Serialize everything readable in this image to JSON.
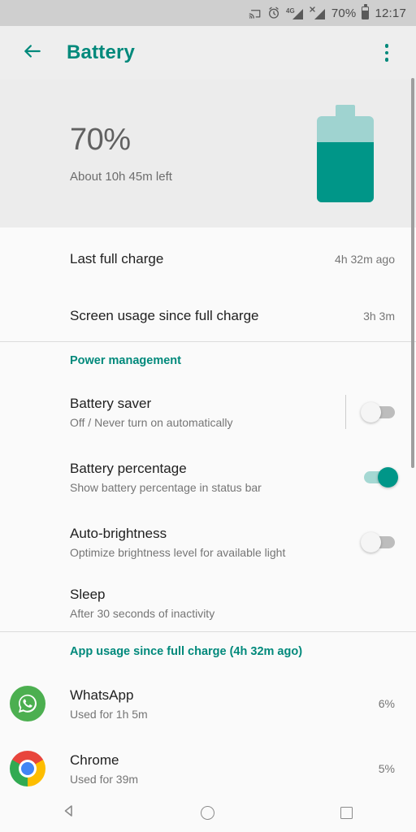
{
  "statusbar": {
    "icons": [
      "cast-icon",
      "alarm-icon",
      "signal-4g-icon",
      "signal-no-service-icon"
    ],
    "network_label": "4G",
    "battery_percent": "70%",
    "time": "12:17"
  },
  "toolbar": {
    "back_icon": "back-arrow-icon",
    "title": "Battery",
    "overflow_icon": "overflow-menu-icon",
    "accent_color": "#00897b"
  },
  "summary": {
    "percent": "70%",
    "remaining": "About 10h 45m left",
    "battery_level": 70,
    "fill_color": "#009688",
    "empty_color": "#9fd3d0"
  },
  "info_rows": [
    {
      "title": "Last full charge",
      "value": "4h 32m ago"
    },
    {
      "title": "Screen usage since full charge",
      "value": "3h 3m"
    }
  ],
  "power_management": {
    "header": "Power management",
    "items": [
      {
        "title": "Battery saver",
        "subtitle": "Off / Never turn on automatically",
        "toggle": "off",
        "has_toggle": true,
        "has_divider": true
      },
      {
        "title": "Battery percentage",
        "subtitle": "Show battery percentage in status bar",
        "toggle": "on",
        "has_toggle": true,
        "has_divider": false
      },
      {
        "title": "Auto-brightness",
        "subtitle": "Optimize brightness level for available light",
        "toggle": "off",
        "has_toggle": true,
        "has_divider": false
      },
      {
        "title": "Sleep",
        "subtitle": "After 30 seconds of inactivity",
        "toggle": "",
        "has_toggle": false,
        "has_divider": false
      }
    ]
  },
  "app_usage": {
    "header": "App usage since full charge (4h 32m ago)",
    "apps": [
      {
        "name": "WhatsApp",
        "usage": "Used for 1h 5m",
        "percent": "6%",
        "icon": "whatsapp-icon"
      },
      {
        "name": "Chrome",
        "usage": "Used for 39m",
        "percent": "5%",
        "icon": "chrome-icon"
      }
    ]
  },
  "navbar": {
    "back": "nav-back-icon",
    "home": "nav-home-icon",
    "recents": "nav-recents-icon"
  }
}
